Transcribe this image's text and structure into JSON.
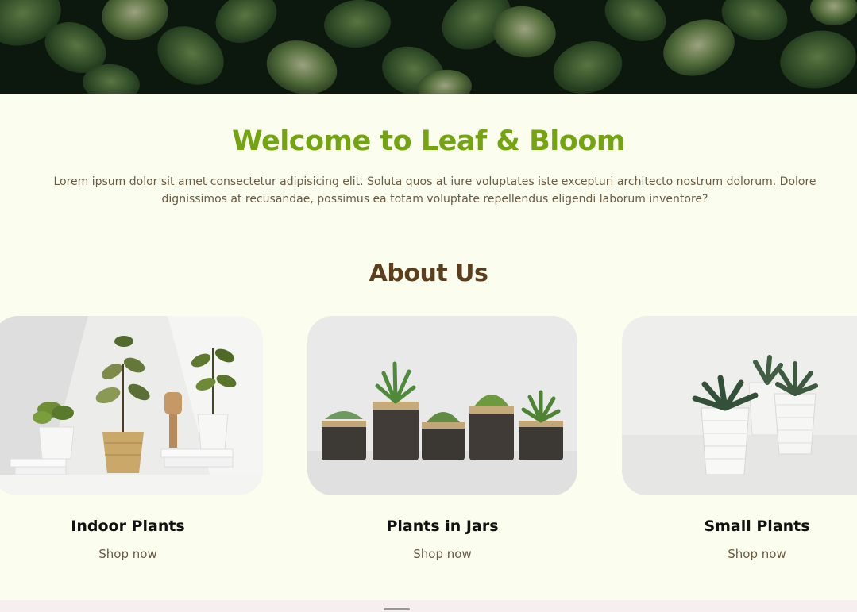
{
  "hero": {
    "image": "dark green foliage leaves"
  },
  "welcome": {
    "title": "Welcome to Leaf & Bloom",
    "text": "Lorem ipsum dolor sit amet consectetur adipisicing elit. Soluta quos at iure voluptates iste excepturi architecto nostrum dolorum. Dolore dignissimos at recusandae, possimus ea totam voluptate repellendus eligendi laborum inventore?"
  },
  "about": {
    "title": "About Us",
    "cards": [
      {
        "title": "Indoor Plants",
        "link": "Shop now",
        "image": "potted indoor plants on white shelf"
      },
      {
        "title": "Plants in Jars",
        "link": "Shop now",
        "image": "succulents in glass jars"
      },
      {
        "title": "Small Plants",
        "link": "Shop now",
        "image": "small succulents in white ribbed pots"
      }
    ]
  },
  "colors": {
    "background": "#fbfdee",
    "welcome_title": "#74a511",
    "about_title": "#5c3e1c",
    "body_text": "#6a5a44"
  }
}
